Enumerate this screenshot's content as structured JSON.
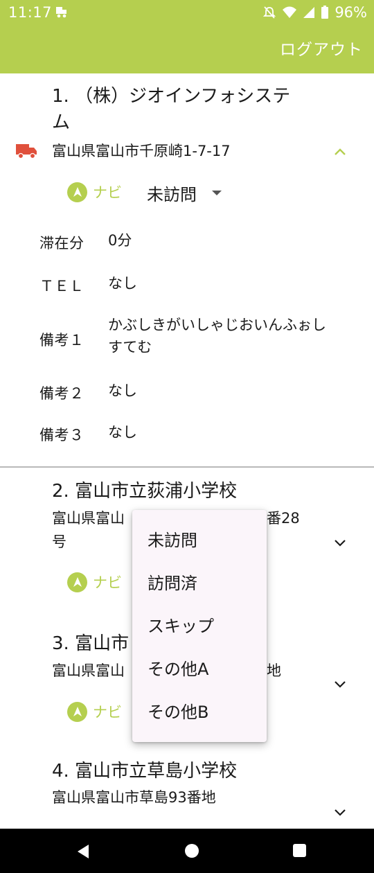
{
  "status_bar": {
    "time": "11:17",
    "battery": "96%"
  },
  "app_bar": {
    "logout_label": "ログアウト"
  },
  "colors": {
    "accent": "#b5cf4f",
    "truck": "#e0503c"
  },
  "stops": [
    {
      "title_line1": "1. （株）ジオインフォシステ",
      "title_line2": "ム",
      "address": "富山県富山市千原崎1-7-17",
      "navi_label": "ナビ",
      "status": "未訪問",
      "details": [
        {
          "label": "滞在分",
          "value": "0分"
        },
        {
          "label": "ＴＥＬ",
          "value": "なし"
        },
        {
          "label": "備考１",
          "value": "かぶしきがいしゃじおいんふぉし",
          "value2": "すてむ"
        },
        {
          "label": "備考２",
          "value": "なし"
        },
        {
          "label": "備考３",
          "value": "なし"
        }
      ]
    },
    {
      "title": "2. 富山市立荻浦小学校",
      "address_left": "富山県富山",
      "address_right": "番28",
      "address_line2": "号",
      "navi_label": "ナビ"
    },
    {
      "title": "3. 富山市",
      "address_left": "富山県富山",
      "address_right": "地",
      "navi_label": "ナビ"
    },
    {
      "title": "4. 富山市立草島小学校",
      "address": "富山県富山市草島93番地"
    }
  ],
  "dropdown": {
    "options": [
      "未訪問",
      "訪問済",
      "スキップ",
      "その他A",
      "その他B"
    ]
  }
}
